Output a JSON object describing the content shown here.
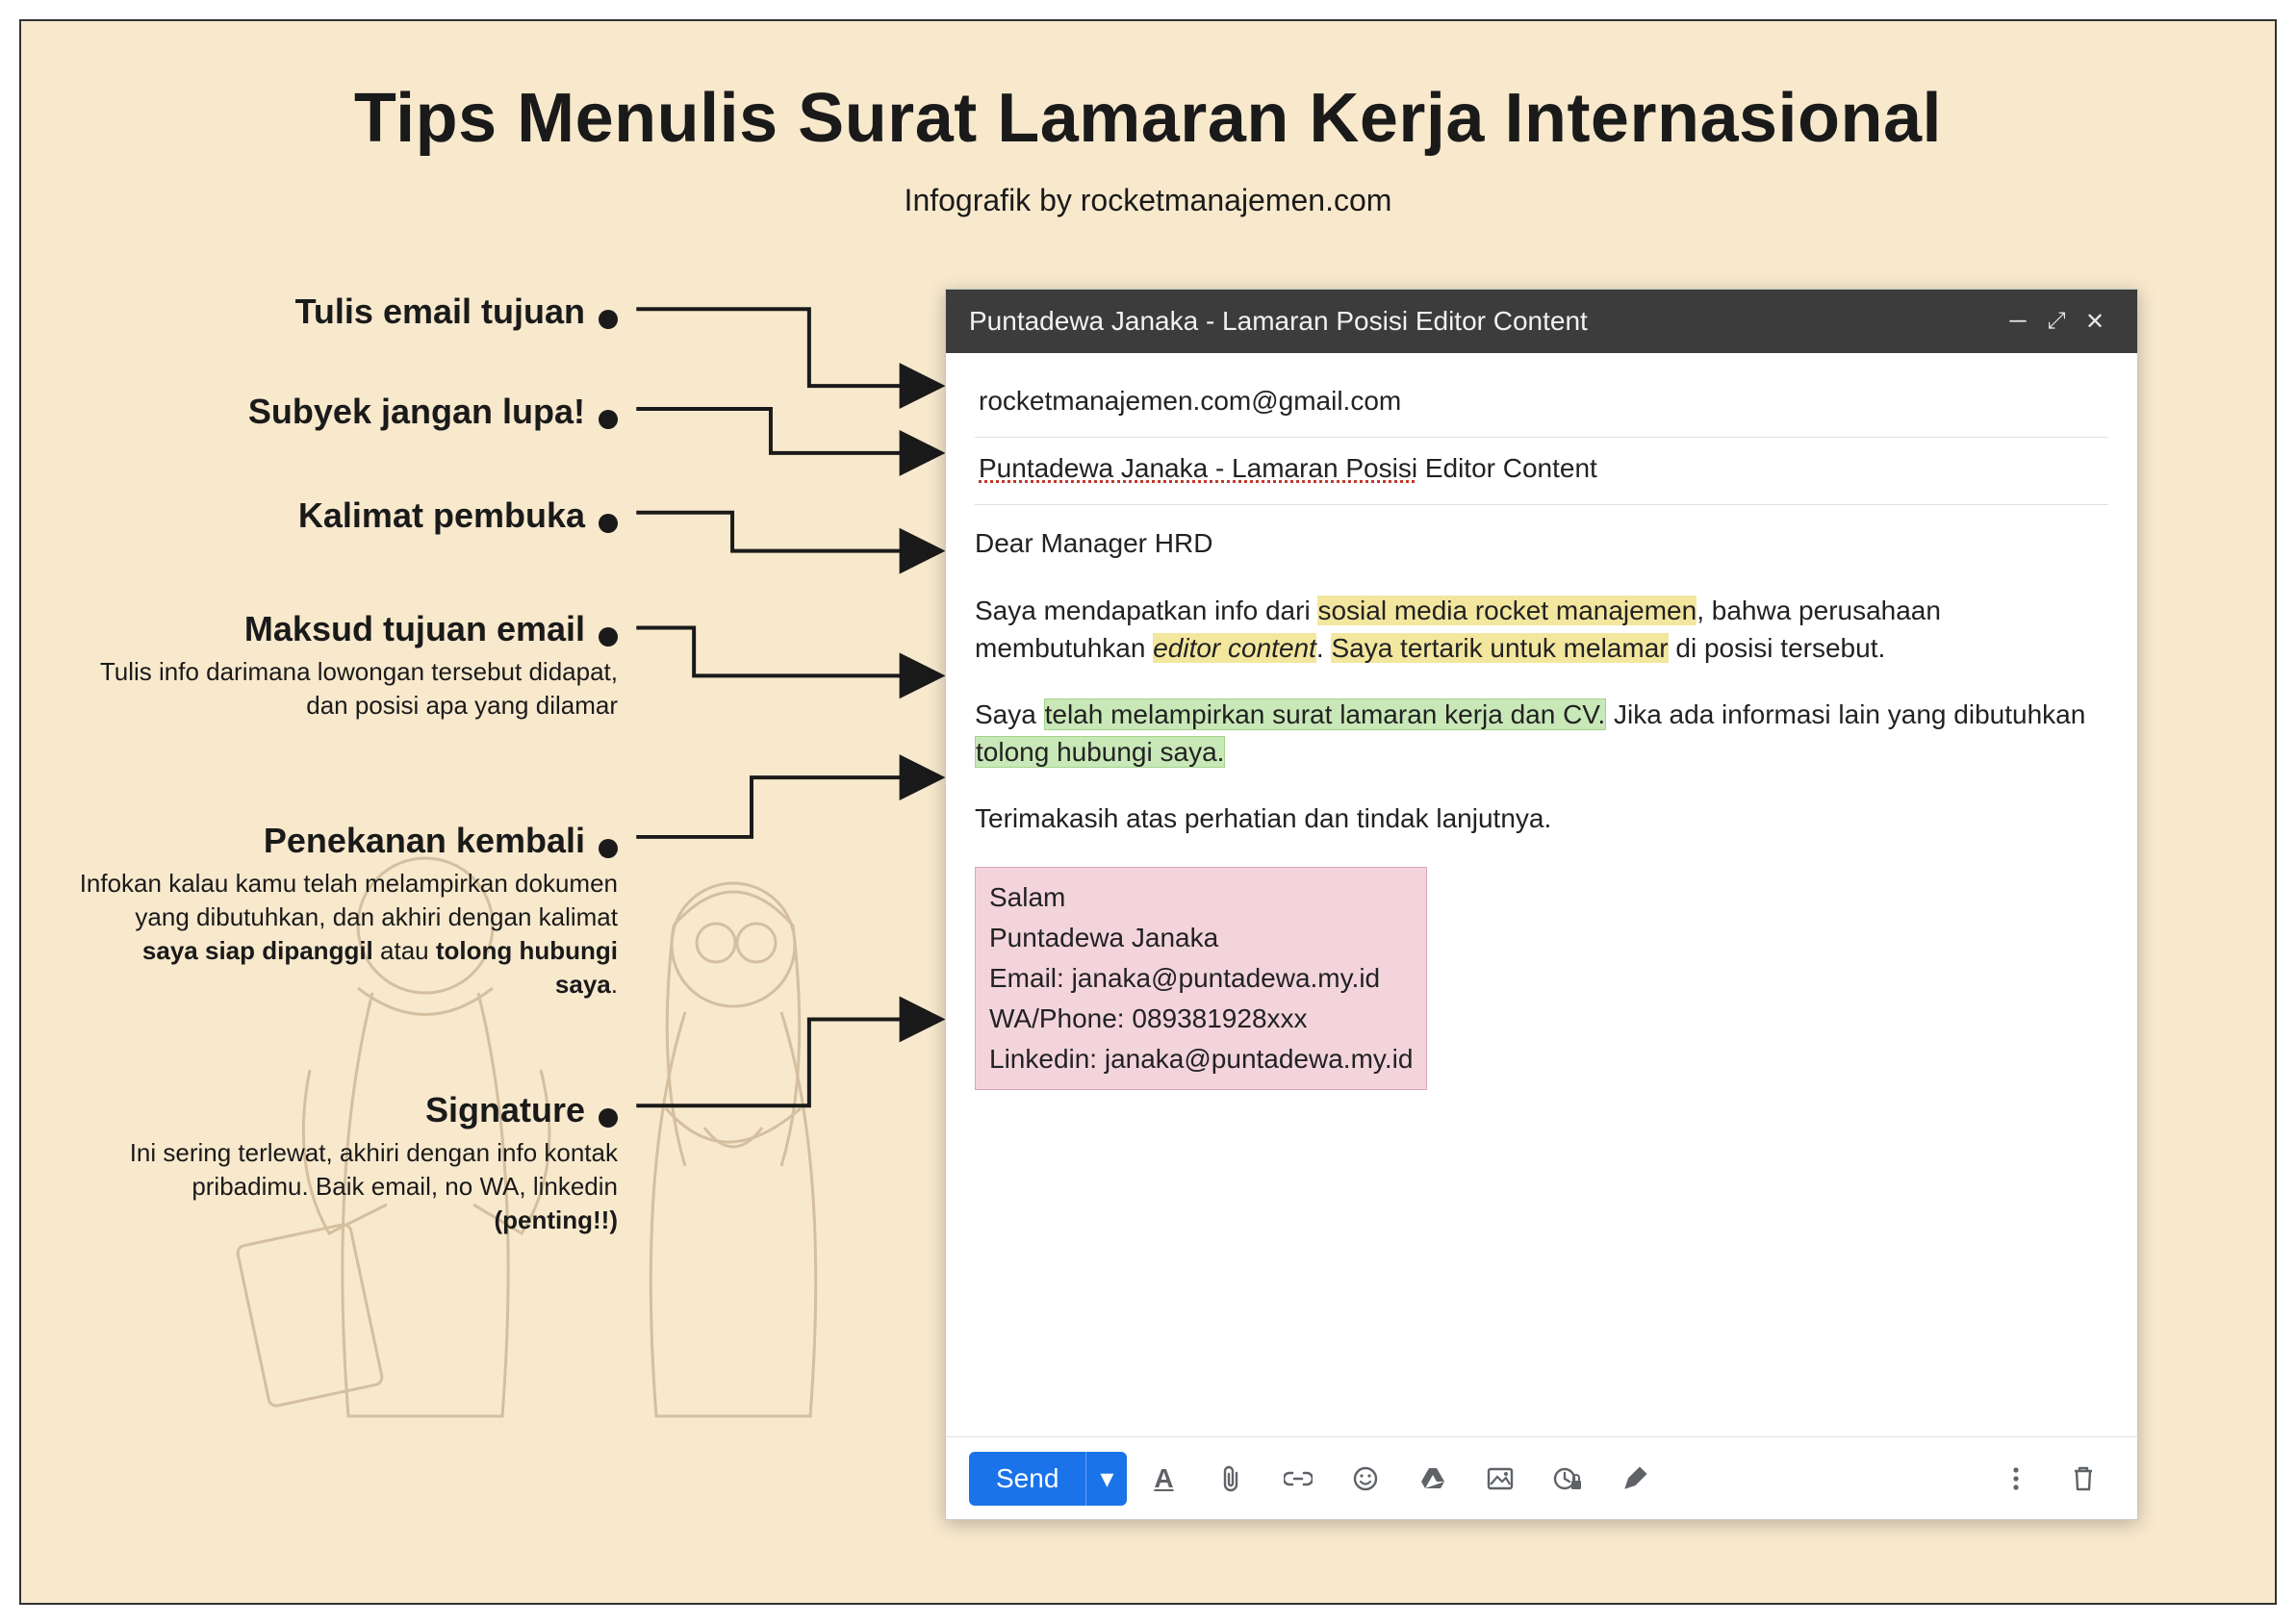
{
  "header": {
    "title": "Tips Menulis Surat Lamaran Kerja Internasional",
    "subtitle": "Infografik by rocketmanajemen.com"
  },
  "labels": {
    "l1": {
      "title": "Tulis email tujuan"
    },
    "l2": {
      "title": "Subyek jangan lupa!"
    },
    "l3": {
      "title": "Kalimat pembuka"
    },
    "l4": {
      "title": "Maksud tujuan email",
      "desc": "Tulis info darimana lowongan tersebut didapat, dan posisi apa yang dilamar"
    },
    "l5": {
      "title": "Penekanan kembali",
      "desc_pre": "Infokan kalau kamu telah melampirkan dokumen yang dibutuhkan, dan akhiri dengan kalimat ",
      "desc_b1": "saya siap dipanggil",
      "desc_mid": " atau ",
      "desc_b2": "tolong hubungi saya",
      "desc_end": "."
    },
    "l6": {
      "title": "Signature",
      "desc_pre": "Ini sering terlewat, akhiri dengan info kontak pribadimu. Baik email, no WA, linkedin ",
      "desc_b": "(penting!!)"
    }
  },
  "email": {
    "window_title": "Puntadewa Janaka - Lamaran Posisi Editor Content",
    "to": "rocketmanajemen.com@gmail.com",
    "subject_wavy": "Puntadewa Janaka - Lamaran Posisi",
    "subject_rest": " Editor Content",
    "greeting": "Dear Manager HRD",
    "p1_a": "Saya mendapatkan info dari ",
    "p1_hl1": "sosial media rocket manajemen",
    "p1_b": ", bahwa perusahaan membutuhkan ",
    "p1_hl2": "editor content",
    "p1_c": ". ",
    "p1_hl3": "Saya tertarik untuk melamar",
    "p1_d": " di posisi tersebut.",
    "p2_a": "Saya ",
    "p2_hl1": "telah melampirkan surat lamaran kerja dan CV.",
    "p2_b": " Jika ada informasi lain yang dibutuhkan ",
    "p2_hl2": "tolong hubungi saya.",
    "p3": "Terimakasih atas perhatian dan tindak lanjutnya.",
    "sig": {
      "l1": "Salam",
      "l2": "Puntadewa Janaka",
      "l3": "Email: janaka@puntadewa.my.id",
      "l4": "WA/Phone: 089381928xxx",
      "l5": "Linkedin: janaka@puntadewa.my.id"
    },
    "toolbar": {
      "send": "Send"
    }
  }
}
